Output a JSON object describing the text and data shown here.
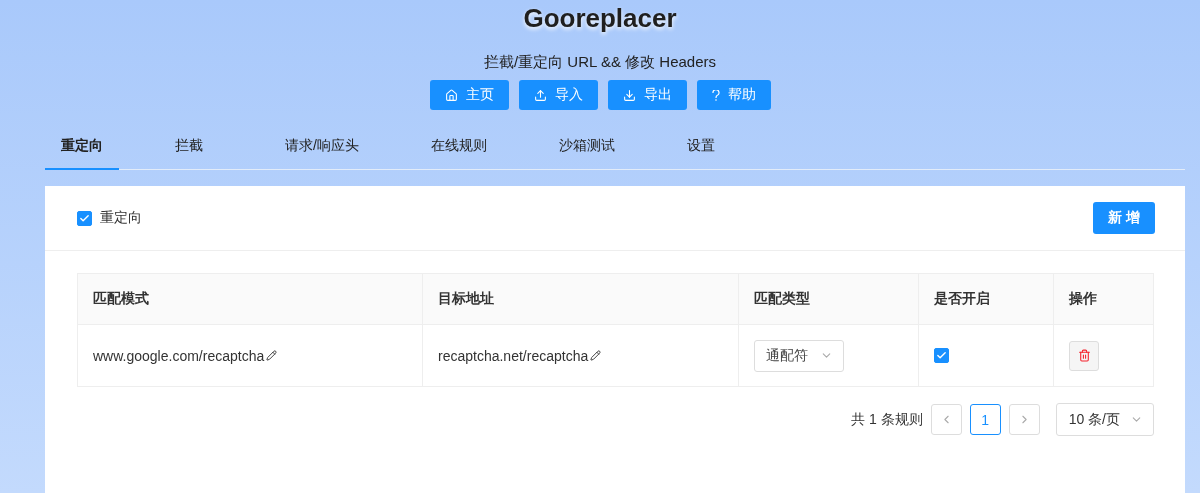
{
  "title": "Gooreplacer",
  "subtitle": "拦截/重定向 URL && 修改 Headers",
  "nav_buttons": [
    {
      "label": "主页"
    },
    {
      "label": "导入"
    },
    {
      "label": "导出"
    },
    {
      "label": "帮助"
    }
  ],
  "tabs": [
    {
      "label": "重定向",
      "selected": true
    },
    {
      "label": "拦截",
      "selected": false
    },
    {
      "label": "请求/响应头",
      "selected": false
    },
    {
      "label": "在线规则",
      "selected": false
    },
    {
      "label": "沙箱测试",
      "selected": false
    },
    {
      "label": "设置",
      "selected": false
    }
  ],
  "panel": {
    "enable": {
      "label": "重定向",
      "checked": true
    },
    "add_button": "新 增"
  },
  "table": {
    "columns": [
      "匹配模式",
      "目标地址",
      "匹配类型",
      "是否开启",
      "操作"
    ],
    "rows": [
      {
        "pattern": "www.google.com/recaptcha",
        "target": "recaptcha.net/recaptcha",
        "match_type": "通配符",
        "enabled": true
      }
    ]
  },
  "pagination": {
    "total": "共 1 条规则",
    "pages": [
      {
        "label": "1",
        "selected": true
      }
    ],
    "page_size": "10 条/页"
  }
}
